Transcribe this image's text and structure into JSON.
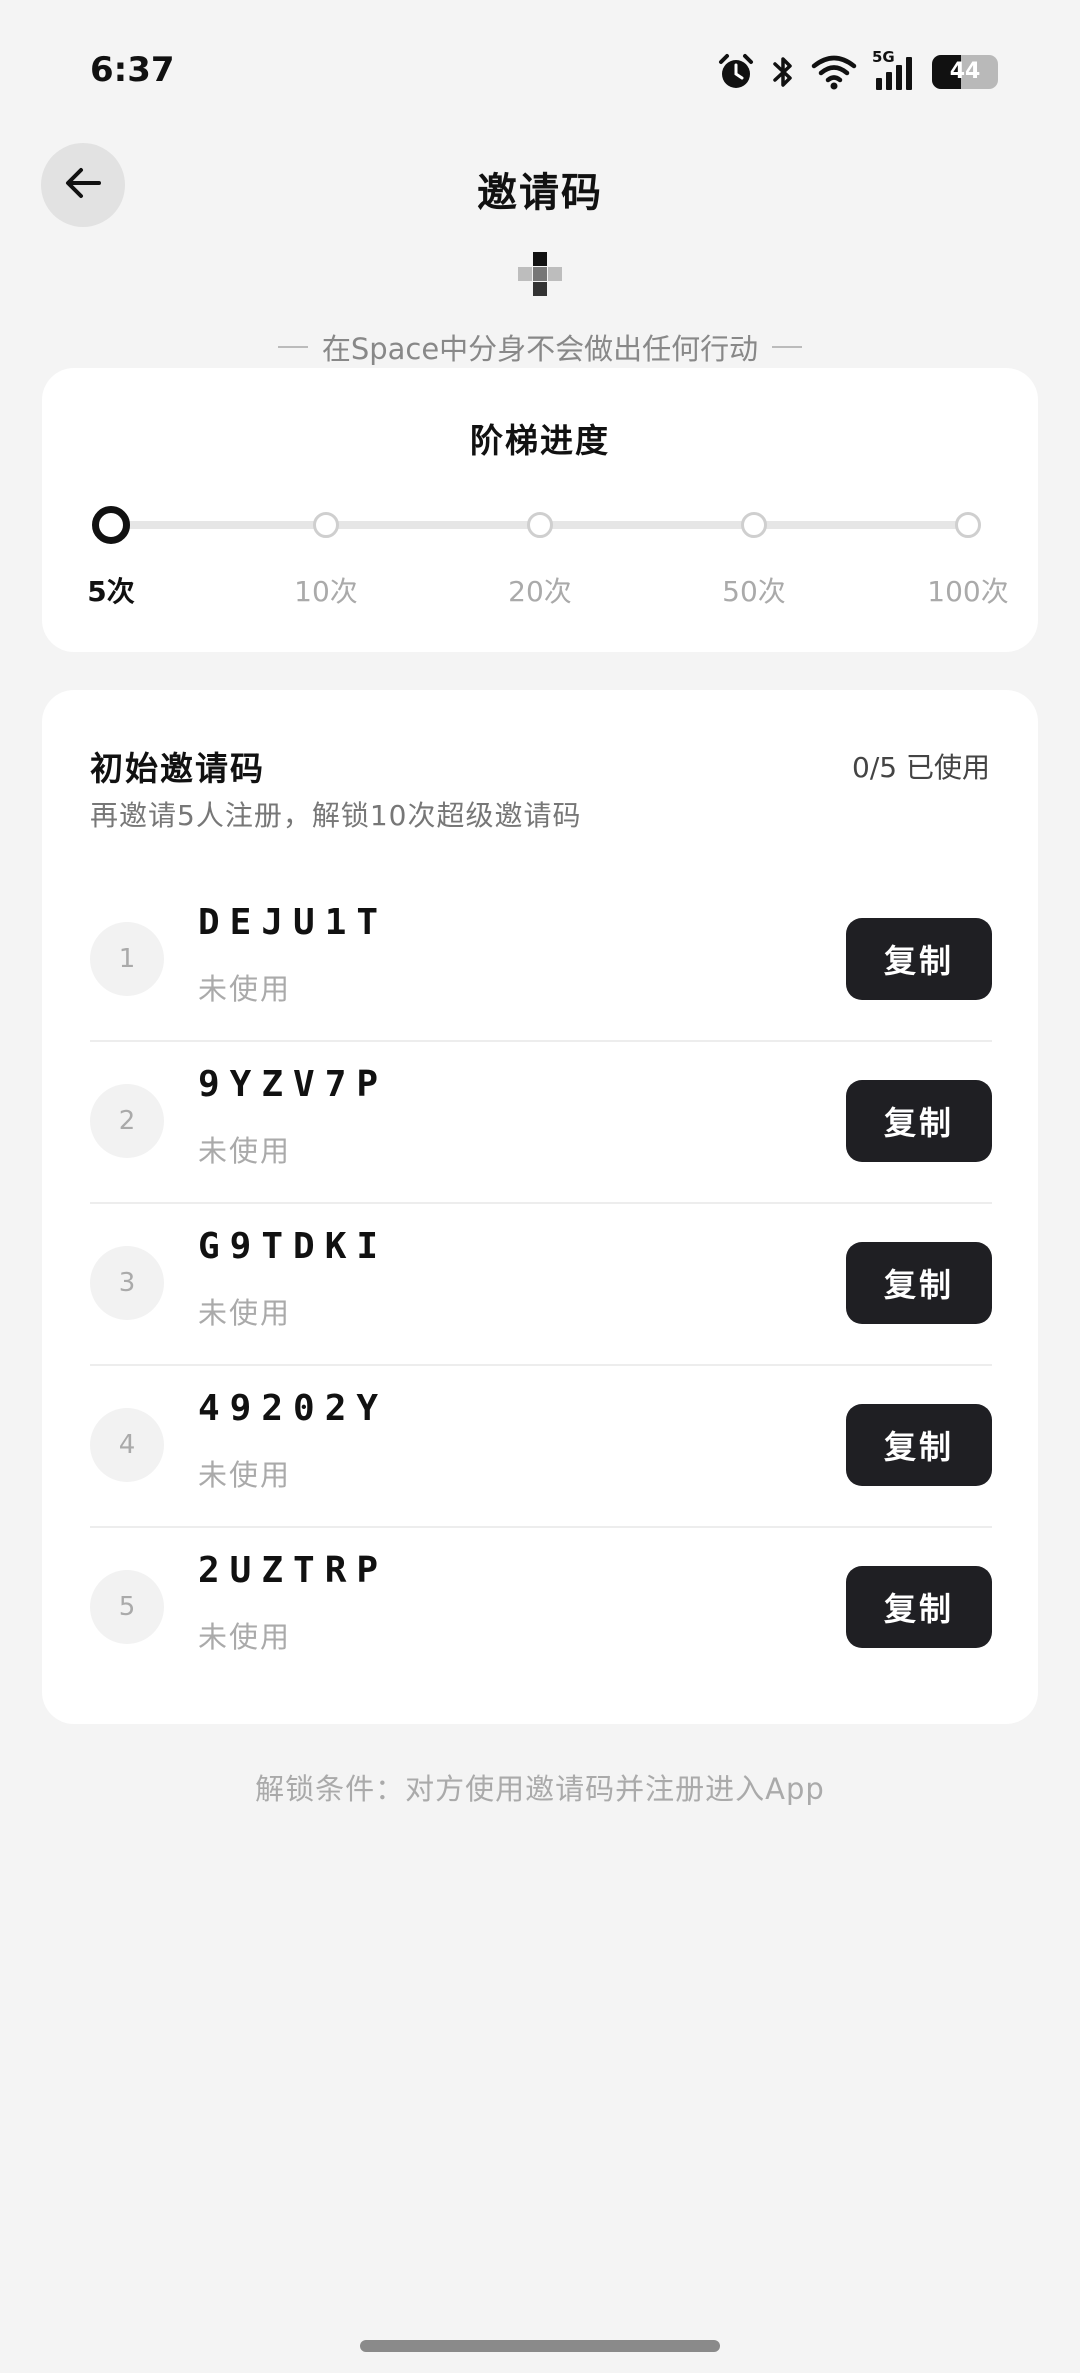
{
  "status_bar": {
    "time": "6:37",
    "network": "5G",
    "battery": "44",
    "icons": [
      "alarm-icon",
      "bluetooth-icon",
      "wifi-icon",
      "signal-5g-icon",
      "battery-icon"
    ]
  },
  "header": {
    "title": "邀请码",
    "back_icon": "arrow-left-icon"
  },
  "tagline": "在Space中分身不会做出任何行动",
  "progress": {
    "title": "阶梯进度",
    "steps": [
      {
        "label": "5次",
        "active": true
      },
      {
        "label": "10次",
        "active": false
      },
      {
        "label": "20次",
        "active": false
      },
      {
        "label": "50次",
        "active": false
      },
      {
        "label": "100次",
        "active": false
      }
    ]
  },
  "codes": {
    "title": "初始邀请码",
    "usage": "0/5 已使用",
    "subtitle": "再邀请5人注册，解锁10次超级邀请码",
    "items": [
      {
        "index": "1",
        "code": "DEJU1T",
        "status": "未使用",
        "copy_label": "复制"
      },
      {
        "index": "2",
        "code": "9YZV7P",
        "status": "未使用",
        "copy_label": "复制"
      },
      {
        "index": "3",
        "code": "G9TDKI",
        "status": "未使用",
        "copy_label": "复制"
      },
      {
        "index": "4",
        "code": "49202Y",
        "status": "未使用",
        "copy_label": "复制"
      },
      {
        "index": "5",
        "code": "2UZTRP",
        "status": "未使用",
        "copy_label": "复制"
      }
    ]
  },
  "unlock_note": "解锁条件：对方使用邀请码并注册进入App",
  "colors": {
    "background": "#f4f4f4",
    "card": "#ffffff",
    "button": "#1f1f23",
    "muted_text": "#aaaaaa"
  }
}
